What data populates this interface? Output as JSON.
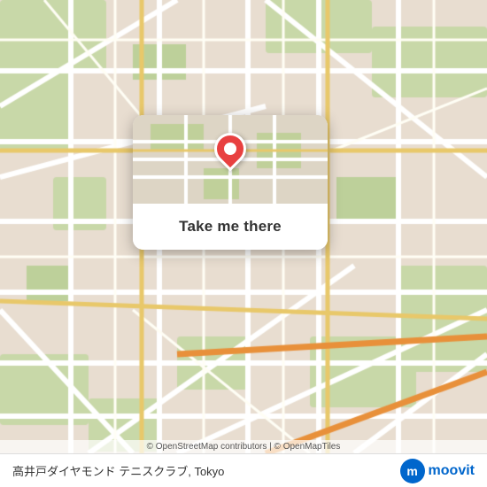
{
  "map": {
    "background_color": "#ede3d8",
    "attribution": "© OpenStreetMap contributors | © OpenMapTiles"
  },
  "popup": {
    "button_label": "Take me there"
  },
  "bottom_bar": {
    "location_text": "高井戸ダイヤモンド テニスクラブ, Tokyo",
    "logo_letter": "m"
  },
  "brand": {
    "name": "moovit",
    "color": "#0066cc"
  }
}
